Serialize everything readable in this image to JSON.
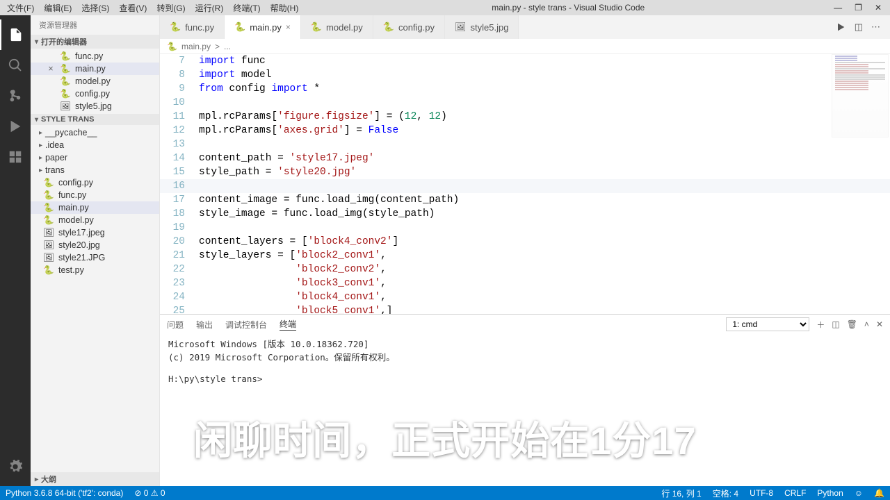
{
  "title": "main.py - style trans - Visual Studio Code",
  "menus": [
    "文件(F)",
    "编辑(E)",
    "选择(S)",
    "查看(V)",
    "转到(G)",
    "运行(R)",
    "终端(T)",
    "帮助(H)"
  ],
  "win_ctrl": {
    "min": "—",
    "max": "❐",
    "close": "✕"
  },
  "sidebar": {
    "title": "资源管理器",
    "openEditorsTitle": "打开的编辑器",
    "openEditors": [
      {
        "name": "func.py",
        "icon": "🐍"
      },
      {
        "name": "main.py",
        "icon": "🐍",
        "active": true,
        "close": "×"
      },
      {
        "name": "model.py",
        "icon": "🐍"
      },
      {
        "name": "config.py",
        "icon": "🐍"
      },
      {
        "name": "style5.jpg",
        "icon": "🖼"
      }
    ],
    "projectTitle": "STYLE TRANS",
    "folders": [
      "__pycache__",
      ".idea",
      "paper",
      "trans"
    ],
    "files": [
      {
        "name": "config.py",
        "icon": "🐍"
      },
      {
        "name": "func.py",
        "icon": "🐍"
      },
      {
        "name": "main.py",
        "icon": "🐍",
        "active": true
      },
      {
        "name": "model.py",
        "icon": "🐍"
      },
      {
        "name": "style17.jpeg",
        "icon": "🖼"
      },
      {
        "name": "style20.jpg",
        "icon": "🖼"
      },
      {
        "name": "style21.JPG",
        "icon": "🖼"
      },
      {
        "name": "test.py",
        "icon": "🐍"
      }
    ],
    "outline": "大纲"
  },
  "tabs": [
    {
      "label": "func.py",
      "icon": "🐍"
    },
    {
      "label": "main.py",
      "icon": "🐍",
      "active": true,
      "close": "×"
    },
    {
      "label": "model.py",
      "icon": "🐍"
    },
    {
      "label": "config.py",
      "icon": "🐍"
    },
    {
      "label": "style5.jpg",
      "icon": "🖼"
    }
  ],
  "breadcrumb": {
    "file": "main.py",
    "sep": ">",
    "rest": "..."
  },
  "code": [
    {
      "n": 7,
      "html": "<span class='tok-kw'>import</span> func"
    },
    {
      "n": 8,
      "html": "<span class='tok-kw'>import</span> model"
    },
    {
      "n": 9,
      "html": "<span class='tok-kw'>from</span> config <span class='tok-kw'>import</span> *"
    },
    {
      "n": 10,
      "html": ""
    },
    {
      "n": 11,
      "html": "mpl.rcParams[<span class='tok-str'>'figure.figsize'</span>] = (<span class='tok-num'>12</span>, <span class='tok-num'>12</span>)"
    },
    {
      "n": 12,
      "html": "mpl.rcParams[<span class='tok-str'>'axes.grid'</span>] = <span class='tok-const'>False</span>"
    },
    {
      "n": 13,
      "html": ""
    },
    {
      "n": 14,
      "html": "content_path = <span class='tok-str'>'style17.jpeg'</span>"
    },
    {
      "n": 15,
      "html": "style_path = <span class='tok-str'>'style20.jpg'</span>"
    },
    {
      "n": 16,
      "html": "",
      "hl": true
    },
    {
      "n": 17,
      "html": "content_image = func.load_img(content_path)"
    },
    {
      "n": 18,
      "html": "style_image = func.load_img(style_path)"
    },
    {
      "n": 19,
      "html": ""
    },
    {
      "n": 20,
      "html": "content_layers = [<span class='tok-str'>'block4_conv2'</span>]"
    },
    {
      "n": 21,
      "html": "style_layers = [<span class='tok-str'>'block2_conv1'</span>,"
    },
    {
      "n": 22,
      "html": "                <span class='tok-str'>'block2_conv2'</span>,"
    },
    {
      "n": 23,
      "html": "                <span class='tok-str'>'block3_conv1'</span>,"
    },
    {
      "n": 24,
      "html": "                <span class='tok-str'>'block4_conv1'</span>,"
    },
    {
      "n": 25,
      "html": "                <span class='tok-str'>'block5_conv1'</span>,]"
    }
  ],
  "panel": {
    "tabs": [
      "问题",
      "输出",
      "调试控制台",
      "终端"
    ],
    "activeTab": 3,
    "shellSelect": "1: cmd",
    "body": "Microsoft Windows [版本 10.0.18362.720]\n(c) 2019 Microsoft Corporation。保留所有权利。\n\nH:\\py\\style trans>"
  },
  "status": {
    "left": "Python 3.6.8 64-bit ('tf2': conda)",
    "err": "⊘ 0  ⚠ 0",
    "right": [
      "行 16, 列 1",
      "空格: 4",
      "UTF-8",
      "CRLF",
      "Python",
      "☺",
      "🔔"
    ]
  },
  "overlay": "闲聊时间，正式开始在1分17"
}
